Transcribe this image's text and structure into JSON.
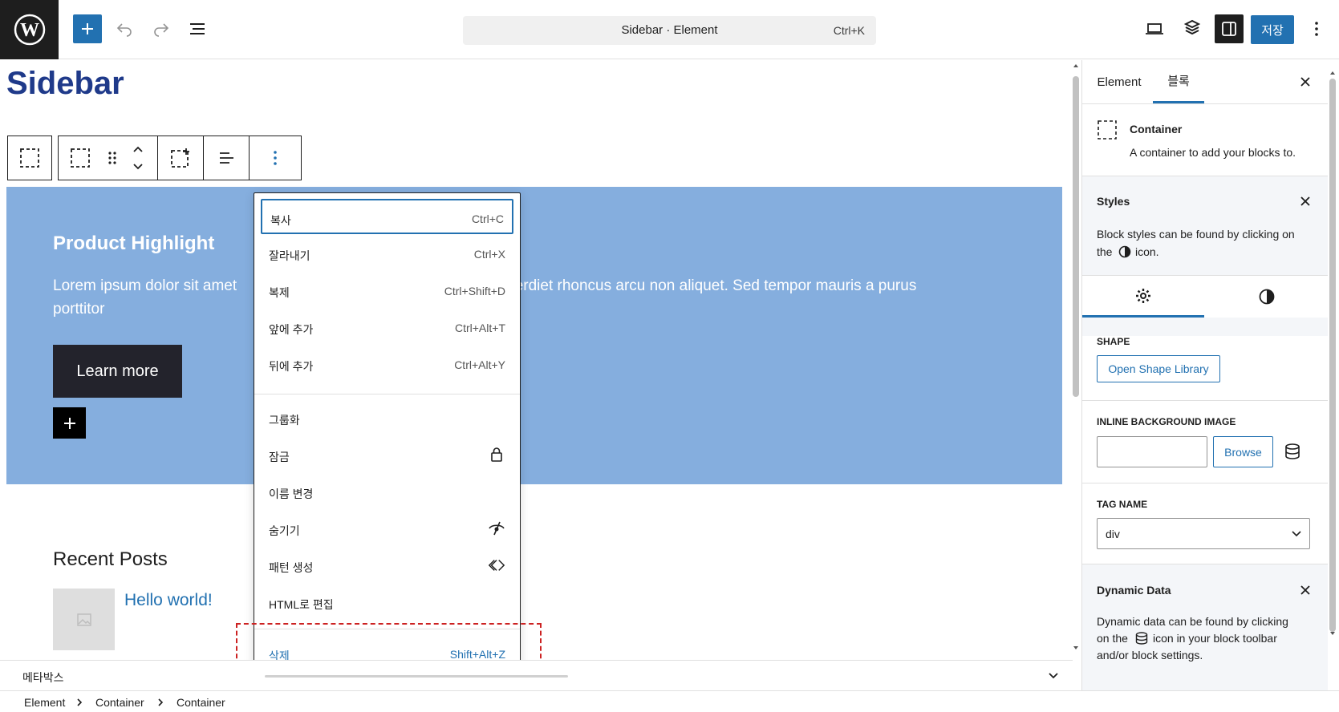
{
  "topbar": {
    "command_title": "Sidebar · Element",
    "command_shortcut": "Ctrl+K",
    "save_label": "저장"
  },
  "canvas": {
    "page_title_peek": "Sidebar",
    "section_heading": "Product Highlight",
    "section_text_left": "Lorem ipsum dolor sit amet",
    "section_text_right": "perdiet rhoncus arcu non aliquet. Sed tempor mauris a purus",
    "section_text_line2": "porttitor",
    "button_label": "Learn more",
    "recent_posts_heading": "Recent Posts",
    "post_link": "Hello world!"
  },
  "context_menu": {
    "items": [
      {
        "label": "복사",
        "shortcut": "Ctrl+C"
      },
      {
        "label": "잘라내기",
        "shortcut": "Ctrl+X"
      },
      {
        "label": "복제",
        "shortcut": "Ctrl+Shift+D"
      },
      {
        "label": "앞에 추가",
        "shortcut": "Ctrl+Alt+T"
      },
      {
        "label": "뒤에 추가",
        "shortcut": "Ctrl+Alt+Y"
      },
      {
        "label": "그룹화",
        "shortcut": ""
      },
      {
        "label": "잠금",
        "icon": "lock-icon"
      },
      {
        "label": "이름 변경",
        "shortcut": ""
      },
      {
        "label": "숨기기",
        "icon": "eye-hidden-icon"
      },
      {
        "label": "패턴 생성",
        "icon": "pattern-icon"
      },
      {
        "label": "HTML로 편집",
        "shortcut": ""
      },
      {
        "label": "삭제",
        "shortcut": "Shift+Alt+Z"
      }
    ]
  },
  "metabox": {
    "label": "메타박스"
  },
  "breadcrumb": {
    "items": [
      "Element",
      "Container",
      "Container"
    ]
  },
  "sidebar": {
    "tabs": [
      "Element",
      "블록"
    ],
    "block_name": "Container",
    "block_description": "A container to add your blocks to.",
    "styles_title": "Styles",
    "styles_text_1": "Block styles can be found by clicking on",
    "styles_text_2a": "the",
    "styles_text_2b": "icon.",
    "shape_label": "SHAPE",
    "shape_button": "Open Shape Library",
    "inline_bg_label": "INLINE BACKGROUND IMAGE",
    "browse_button": "Browse",
    "tag_name_label": "TAG NAME",
    "tag_name_value": "div",
    "dynamic_title": "Dynamic Data",
    "dynamic_text_1": "Dynamic data can be found by clicking",
    "dynamic_text_2a": "on the",
    "dynamic_text_2b": "icon in your block toolbar",
    "dynamic_text_3": "and/or block settings."
  },
  "colors": {
    "accent": "#2271b1",
    "section_bg": "#85aede",
    "highlight_border": "#cc2222"
  }
}
